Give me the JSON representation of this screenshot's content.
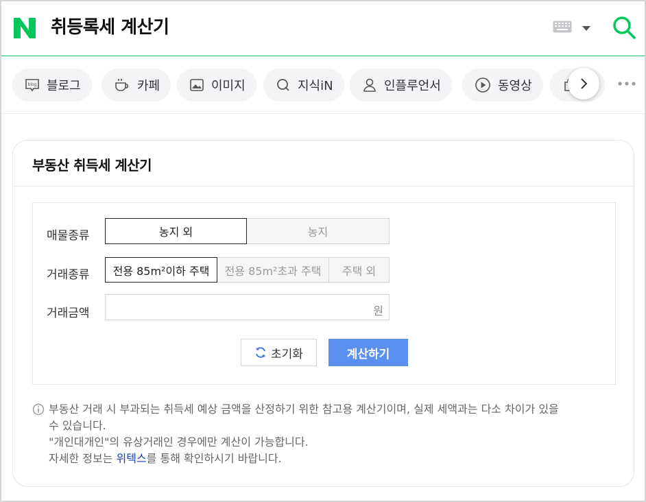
{
  "header": {
    "logo_letter": "N",
    "query": "취등록세 계산기",
    "brand_color": "#03c75a"
  },
  "tabs": [
    {
      "label": "블로그",
      "icon": "blog-icon"
    },
    {
      "label": "카페",
      "icon": "cafe-cup-icon"
    },
    {
      "label": "이미지",
      "icon": "image-icon"
    },
    {
      "label": "지식iN",
      "icon": "q-icon"
    },
    {
      "label": "인플루언서",
      "icon": "person-icon"
    },
    {
      "label": "동영상",
      "icon": "play-icon"
    }
  ],
  "card": {
    "title": "부동산 취득세 계산기",
    "property_type": {
      "label": "매물종류",
      "options": [
        "농지 외",
        "농지"
      ],
      "selected": "농지 외"
    },
    "trade_type": {
      "label": "거래종류",
      "options": [
        "전용 85m²이하 주택",
        "전용 85m²초과 주택",
        "주택 외"
      ],
      "selected": "전용 85m²이하 주택"
    },
    "amount": {
      "label": "거래금액",
      "value": "",
      "unit": "원"
    },
    "reset_label": "초기화",
    "calc_label": "계산하기",
    "calc_color": "#5b8ff0"
  },
  "notes": {
    "line1": "부동산 거래 시 부과되는 취득세 예상 금액을 산정하기 위한 참고용 계산기이며, 실제 세액과는 다소 차이가 있을",
    "line2": "수 있습니다.",
    "line3": "\"개인대개인\"의 유상거래인 경우에만 계산이 가능합니다.",
    "line4_prefix": "자세한 정보는 ",
    "line4_link": "위텍스",
    "line4_suffix": "를 통해 확인하시기 바랍니다."
  }
}
